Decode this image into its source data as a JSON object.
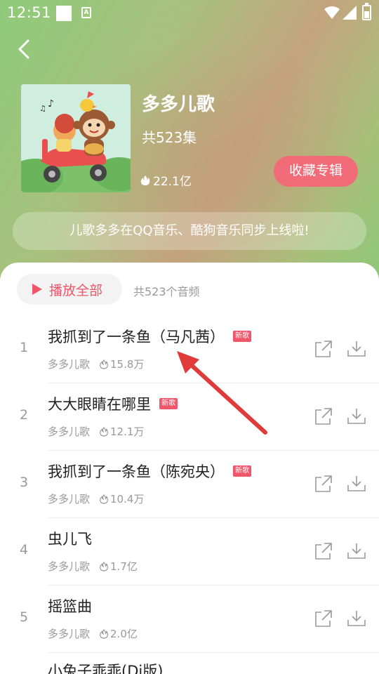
{
  "status_bar": {
    "time": "12:51",
    "icons": [
      "square-notification-icon",
      "a-icon",
      "wifi-icon",
      "signal-icon",
      "battery-icon"
    ]
  },
  "header": {
    "back_icon": "chevron-left-icon",
    "album_title": "多多儿歌",
    "episode_count": "共523集",
    "play_count": "22.1亿",
    "collect_label": "收藏专辑",
    "notice": "儿歌多多在QQ音乐、酷狗音乐同步上线啦!"
  },
  "toolbar": {
    "play_all_label": "播放全部",
    "track_total": "共523个音频"
  },
  "tracks": [
    {
      "index": "1",
      "title": "我抓到了一条鱼（马凡茜）",
      "badge": "新歌",
      "artist": "多多儿歌",
      "plays": "15.8万"
    },
    {
      "index": "2",
      "title": "大大眼睛在哪里",
      "badge": "新歌",
      "artist": "多多儿歌",
      "plays": "12.1万"
    },
    {
      "index": "3",
      "title": "我抓到了一条鱼（陈宛央）",
      "badge": "新歌",
      "artist": "多多儿歌",
      "plays": "10.4万"
    },
    {
      "index": "4",
      "title": "虫儿飞",
      "badge": "",
      "artist": "多多儿歌",
      "plays": "1.7亿"
    },
    {
      "index": "5",
      "title": "摇篮曲",
      "badge": "",
      "artist": "多多儿歌",
      "plays": "2.0亿"
    }
  ],
  "partial_track_title": "小兔子乖乖(Dj版)",
  "colors": {
    "accent": "#f0566a",
    "collect": "#f26b78",
    "annotation_arrow": "#e03a3a"
  }
}
